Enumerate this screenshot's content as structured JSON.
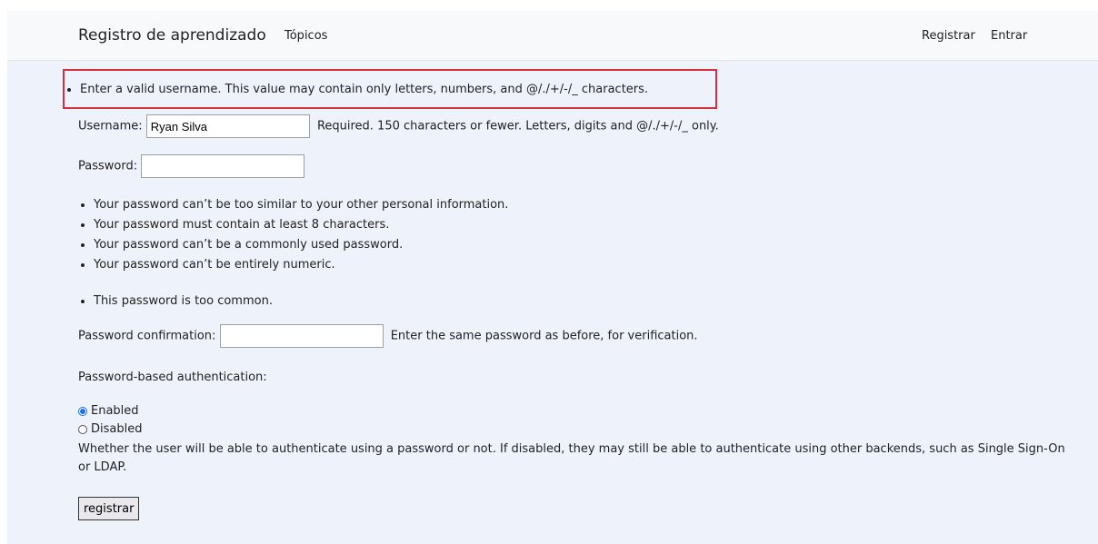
{
  "navbar": {
    "brand": "Registro de aprendizado",
    "topicos": "Tópicos",
    "registrar": "Registrar",
    "entrar": "Entrar"
  },
  "error": {
    "username_error": "Enter a valid username. This value may contain only letters, numbers, and @/./+/-/_ characters."
  },
  "form": {
    "username_label": "Username:",
    "username_value": "Ryan Silva",
    "username_help": "Required. 150 characters or fewer. Letters, digits and @/./+/-/_ only.",
    "password_label": "Password:",
    "password_value": "",
    "password_help": [
      "Your password can’t be too similar to your other personal information.",
      "Your password must contain at least 8 characters.",
      "Your password can’t be a commonly used password.",
      "Your password can’t be entirely numeric."
    ],
    "password_error": "This password is too common.",
    "confirm_label": "Password confirmation:",
    "confirm_value": "",
    "confirm_help": "Enter the same password as before, for verification.",
    "auth_label": "Password-based authentication:",
    "auth_options": [
      "Enabled",
      "Disabled"
    ],
    "auth_selected": "Enabled",
    "auth_help": "Whether the user will be able to authenticate using a password or not. If disabled, they may still be able to authenticate using other backends, such as Single Sign-On or LDAP.",
    "submit_label": "registrar"
  },
  "colors": {
    "background": "#eef3fb",
    "navbar": "#f8f9fa",
    "error_border": "#d1313c",
    "radio_accent": "#1a73e8"
  }
}
